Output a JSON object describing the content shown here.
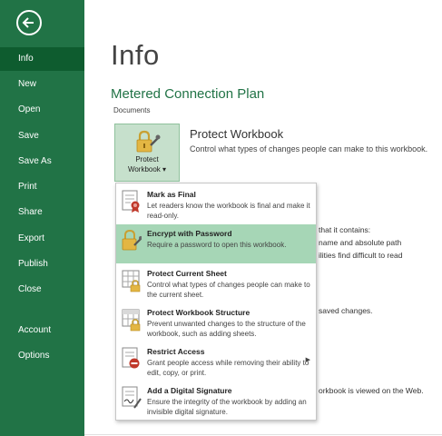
{
  "nav": {
    "items": [
      "Info",
      "New",
      "Open",
      "Save",
      "Save As",
      "Print",
      "Share",
      "Export",
      "Publish",
      "Close",
      "Account",
      "Options"
    ]
  },
  "main": {
    "title": "Info",
    "workbook_name": "Metered Connection Plan",
    "path": "Documents",
    "protect_button": {
      "line1": "Protect",
      "line2": "Workbook ▾"
    },
    "section_title": "Protect Workbook",
    "section_desc": "Control what types of changes people can make to this workbook.",
    "bg_texts": [
      "that it contains:",
      "name and absolute path",
      "ilities find difficult to read",
      "saved changes.",
      "orkbook is viewed on the Web."
    ]
  },
  "dropdown": {
    "items": [
      {
        "title": "Mark as Final",
        "desc": "Let readers know the workbook is final and make it read-only."
      },
      {
        "title": "Encrypt with Password",
        "desc": "Require a password to open this workbook."
      },
      {
        "title": "Protect Current Sheet",
        "desc": "Control what types of changes people can make to the current sheet."
      },
      {
        "title": "Protect Workbook Structure",
        "desc": "Prevent unwanted changes to the structure of the workbook, such as adding sheets."
      },
      {
        "title": "Restrict Access",
        "desc": "Grant people access while removing their ability to edit, copy, or print."
      },
      {
        "title": "Add a Digital Signature",
        "desc": "Ensure the integrity of the workbook by adding an invisible digital signature."
      }
    ]
  },
  "colors": {
    "accent": "#217346",
    "active_nav": "#0e5c2f",
    "hover": "#a6d6b6"
  }
}
